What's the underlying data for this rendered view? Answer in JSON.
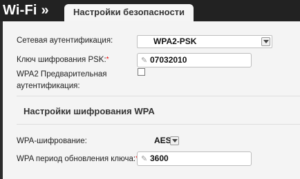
{
  "header": {
    "app_title": "Wi-Fi »",
    "tab_label": "Настройки безопасности"
  },
  "form": {
    "auth_label": "Сетевая аутентификация:",
    "auth_value": "WPA2-PSK",
    "psk_label": "Ключ шифрования PSK:",
    "psk_value": "07032010",
    "preauth_label_1": "WPA2 Предварительная",
    "preauth_label_2": "аутентификация:",
    "preauth_checked": false,
    "section_title": "Настройки шифрования WPA",
    "wpa_enc_label": "WPA-шифрование:",
    "wpa_enc_value": "AES",
    "rekey_label": "WPA период обновления ключа:",
    "rekey_value": "3600",
    "required_mark": "*"
  }
}
